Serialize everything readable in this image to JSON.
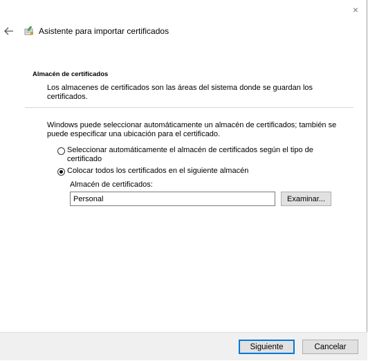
{
  "window": {
    "title": "Asistente para importar certificados",
    "close_glyph": "×"
  },
  "section": {
    "title": "Almacén de certificados",
    "description": "Los almacenes de certificados son las áreas del sistema donde se guardan los certificados."
  },
  "intro_text": "Windows puede seleccionar automáticamente un almacén de certificados; también se puede especificar una ubicación para el certificado.",
  "options": [
    {
      "label": "Seleccionar automáticamente el almacén de certificados según el tipo de certificado",
      "selected": false
    },
    {
      "label": "Colocar todos los certificados en el siguiente almacén",
      "selected": true
    }
  ],
  "store": {
    "label": "Almacén de certificados:",
    "value": "Personal",
    "browse_label": "Examinar..."
  },
  "footer": {
    "next_label": "Siguiente",
    "cancel_label": "Cancelar"
  },
  "colors": {
    "accent": "#0078d7",
    "footer_bg": "#f0f0f0",
    "button_bg": "#e1e1e1"
  },
  "icons": {
    "back": "back-arrow-icon",
    "wizard": "certificate-wizard-icon",
    "close": "close-icon"
  }
}
